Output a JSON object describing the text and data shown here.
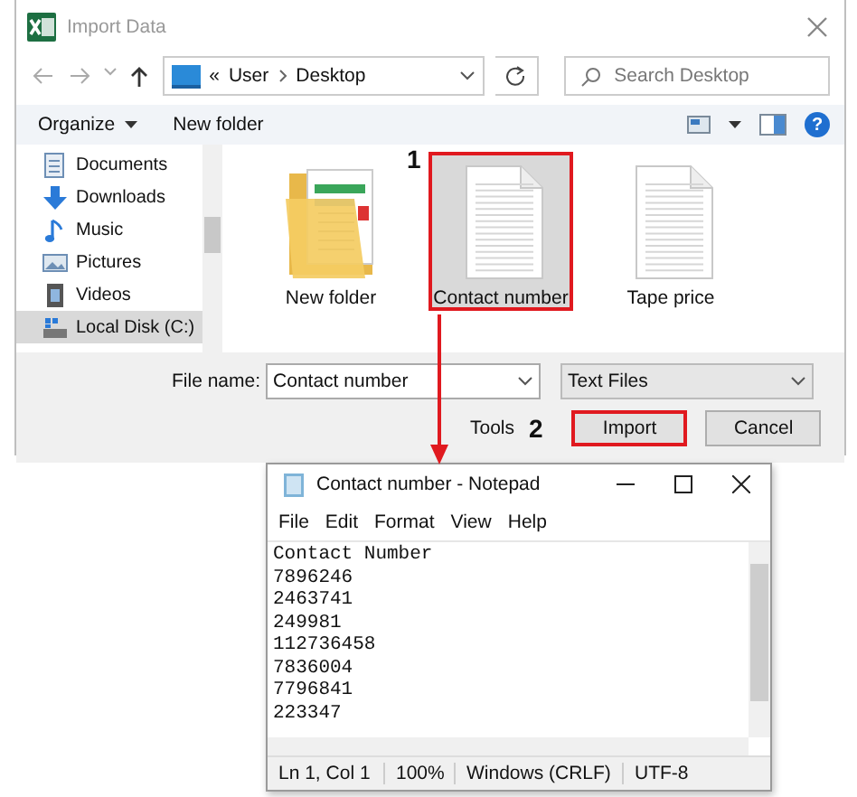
{
  "dialog": {
    "title": "Import Data",
    "nav": {
      "path_prefix": "«",
      "path": [
        "User",
        "Desktop"
      ],
      "search_placeholder": "Search Desktop"
    },
    "toolbar": {
      "organize": "Organize",
      "new_folder": "New folder",
      "help": "?"
    },
    "sidebar": {
      "items": [
        {
          "label": "Documents",
          "kind": "documents",
          "selected": false
        },
        {
          "label": "Downloads",
          "kind": "downloads",
          "selected": false
        },
        {
          "label": "Music",
          "kind": "music",
          "selected": false
        },
        {
          "label": "Pictures",
          "kind": "pictures",
          "selected": false
        },
        {
          "label": "Videos",
          "kind": "videos",
          "selected": false
        },
        {
          "label": "Local Disk (C:)",
          "kind": "disk",
          "selected": true
        }
      ]
    },
    "files": [
      {
        "name": "New folder",
        "kind": "folder",
        "selected": false,
        "annotated": false
      },
      {
        "name": "Contact number",
        "kind": "text",
        "selected": true,
        "annotated": true,
        "step": "1"
      },
      {
        "name": "Tape price",
        "kind": "text",
        "selected": false,
        "annotated": false
      }
    ],
    "file_name": {
      "label": "File name:",
      "value": "Contact number"
    },
    "file_type": "Text Files",
    "tools": "Tools",
    "buttons": [
      {
        "label": "Import",
        "annotated": true,
        "step": "2"
      },
      {
        "label": "Cancel",
        "annotated": false
      }
    ]
  },
  "notepad": {
    "title": "Contact number - Notepad",
    "menu": [
      "File",
      "Edit",
      "Format",
      "View",
      "Help"
    ],
    "lines": [
      "Contact Number",
      "7896246",
      "2463741",
      "249981",
      "112736458",
      "7836004",
      "7796841",
      "223347"
    ],
    "status": [
      "Ln 1, Col 1",
      "100%",
      "Windows (CRLF)",
      "UTF-8"
    ]
  }
}
